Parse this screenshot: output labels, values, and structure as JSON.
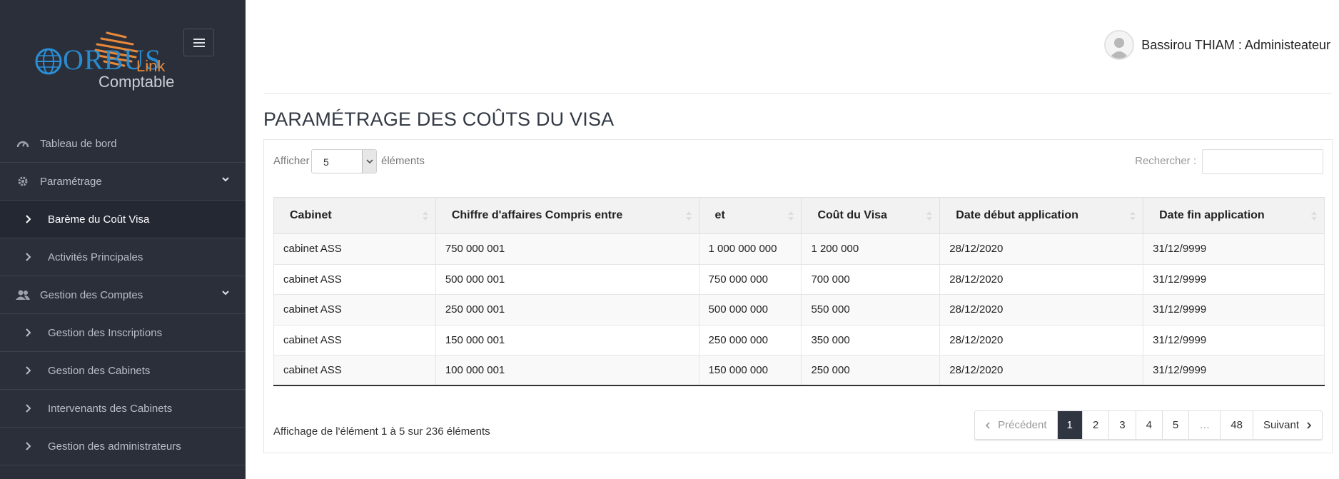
{
  "brand": {
    "name_main": "ORBUS",
    "name_link": "Link",
    "name_sub": "Comptable"
  },
  "sidebar": {
    "items": [
      {
        "label": "Tableau de bord",
        "icon": "dashboard-gauge-icon"
      },
      {
        "label": "Paramétrage",
        "icon": "gear-icon"
      },
      {
        "label": "Barème du Coût Visa",
        "icon": "chevron-right-icon"
      },
      {
        "label": "Activités Principales",
        "icon": "chevron-right-icon"
      },
      {
        "label": "Gestion des Comptes",
        "icon": "users-icon"
      },
      {
        "label": "Gestion des Inscriptions",
        "icon": "chevron-right-icon"
      },
      {
        "label": "Gestion des Cabinets",
        "icon": "chevron-right-icon"
      },
      {
        "label": "Intervenants des Cabinets",
        "icon": "chevron-right-icon"
      },
      {
        "label": "Gestion des administrateurs",
        "icon": "chevron-right-icon"
      }
    ]
  },
  "header": {
    "user": "Bassirou THIAM : Administeateur"
  },
  "page": {
    "title": "PARAMÉTRAGE DES COÛTS DU VISA"
  },
  "table_controls": {
    "show_label": "Afficher",
    "length_value": "5",
    "show_suffix": "éléments",
    "search_label": "Rechercher :",
    "search_value": ""
  },
  "table": {
    "headers": [
      "Cabinet",
      "Chiffre d'affaires Compris entre",
      "et",
      "Coût du Visa",
      "Date début application",
      "Date fin application"
    ],
    "rows": [
      [
        "cabinet ASS",
        "750 000 001",
        "1 000 000 000",
        "1 200 000",
        "28/12/2020",
        "31/12/9999"
      ],
      [
        "cabinet ASS",
        "500 000 001",
        "750 000 000",
        "700 000",
        "28/12/2020",
        "31/12/9999"
      ],
      [
        "cabinet ASS",
        "250 000 001",
        "500 000 000",
        "550 000",
        "28/12/2020",
        "31/12/9999"
      ],
      [
        "cabinet ASS",
        "150 000 001",
        "250 000 000",
        "350 000",
        "28/12/2020",
        "31/12/9999"
      ],
      [
        "cabinet ASS",
        "100 000 001",
        "150 000 000",
        "250 000",
        "28/12/2020",
        "31/12/9999"
      ]
    ]
  },
  "footer": {
    "info": "Affichage de l'élément 1 à 5 sur 236 éléments",
    "prev": "Précédent",
    "next": "Suivant",
    "pages": [
      "1",
      "2",
      "3",
      "4",
      "5",
      "…",
      "48"
    ],
    "current_page": "1"
  },
  "colors": {
    "sidebar_bg": "#2a2f3a",
    "accent_dark": "#2f3541",
    "brand_blue": "#2a8fd6",
    "brand_orange": "#e8893a"
  }
}
